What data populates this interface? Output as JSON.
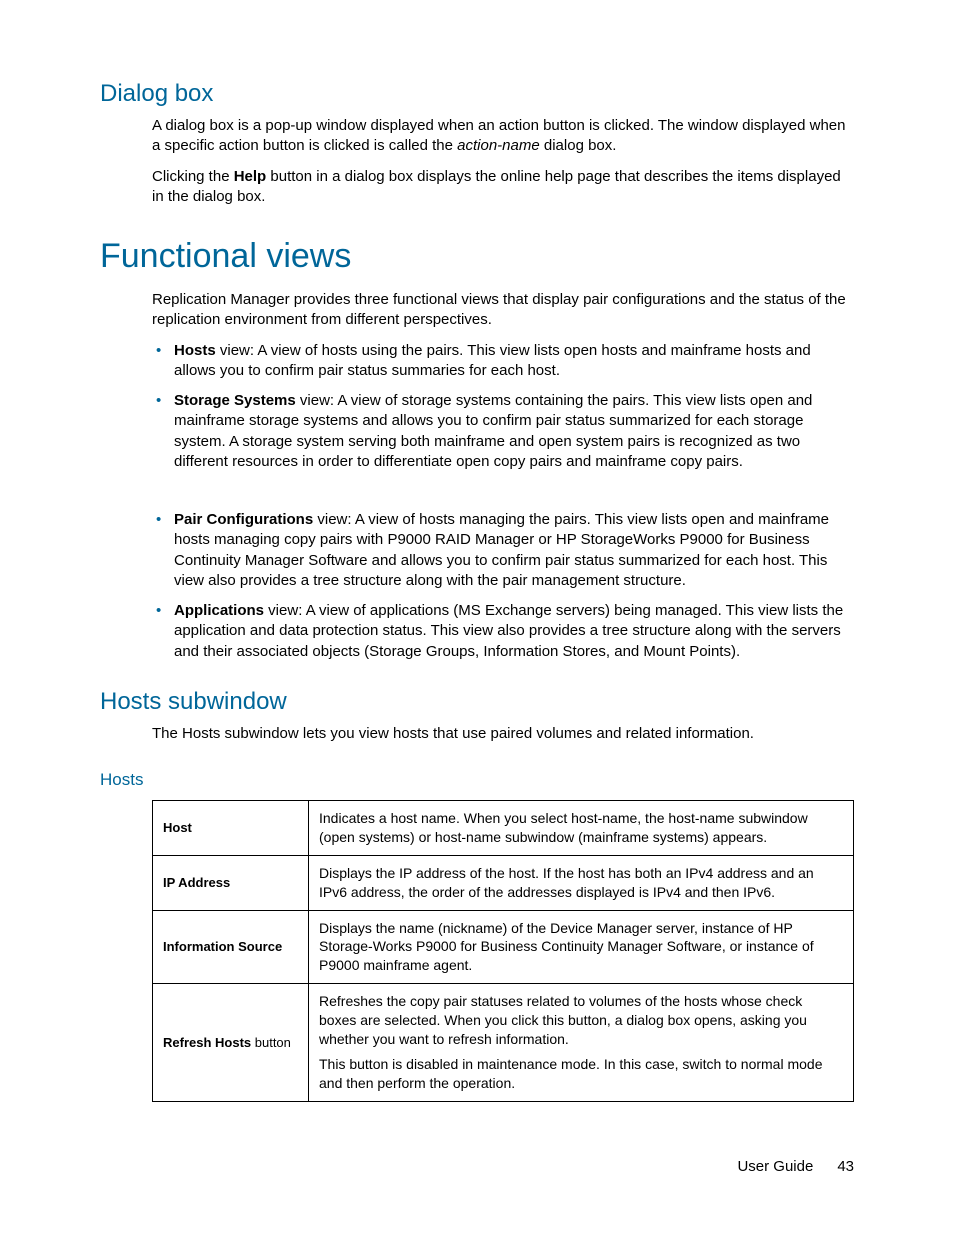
{
  "sec1": {
    "title": "Dialog box",
    "p1a": "A dialog box is a pop-up window displayed when an action button is clicked. The window displayed when a specific action button is clicked is called the ",
    "p1i": "action-name",
    "p1b": " dialog box.",
    "p2a": "Clicking the ",
    "p2bold": "Help",
    "p2b": " button in a dialog box displays the online help page that describes the items displayed in the dialog box."
  },
  "sec2": {
    "title": "Functional views",
    "intro": "Replication Manager provides three functional views that display pair configurations and the status of the replication environment from different perspectives.",
    "items": [
      {
        "bold": "Hosts",
        "rest": " view: A view of hosts using the pairs. This view lists open hosts and mainframe hosts and allows you to confirm pair status summaries for each host."
      },
      {
        "bold": "Storage Systems",
        "rest": " view: A view of storage systems containing the pairs. This view lists open and mainframe storage systems and allows you to confirm pair status summarized for each storage system. A storage system serving both mainframe and open system pairs is recognized as two different resources in order to differentiate open copy pairs and mainframe copy pairs."
      },
      {
        "bold": "Pair Configurations",
        "rest": " view: A view of hosts managing the pairs. This view lists open and mainframe hosts managing copy pairs with P9000 RAID Manager or HP StorageWorks P9000 for Business Continuity Manager Software and allows you to confirm pair status summarized for each host. This view also provides a tree structure along with the pair management structure."
      },
      {
        "bold": "Applications",
        "rest": " view: A view of applications (MS Exchange servers) being managed. This view lists the application and data protection status. This view also provides a tree structure along with the servers and their associated objects (Storage Groups, Information Stores, and Mount Points)."
      }
    ]
  },
  "sec3": {
    "title": "Hosts subwindow",
    "intro": "The Hosts subwindow lets you view hosts that use paired volumes and related information.",
    "sub": "Hosts",
    "rows": [
      {
        "label": "Host",
        "desc": "Indicates a host name. When you select host-name, the host-name subwindow (open systems) or host-name subwindow (mainframe systems) appears."
      },
      {
        "label": "IP Address",
        "desc": "Displays the IP address of the host. If the host has both an IPv4 address and an IPv6 address, the order of the addresses displayed is IPv4 and then IPv6."
      },
      {
        "label": "Information Source",
        "desc": "Displays the name (nickname) of the Device Manager server, instance of HP Storage-Works P9000 for Business Continuity Manager Software, or instance of P9000 mainframe agent."
      },
      {
        "label": "Refresh Hosts",
        "labelSuffix": " button",
        "desc1": "Refreshes the copy pair statuses related to volumes of the hosts whose check boxes are selected. When you click this button, a dialog box opens, asking you whether you want to refresh information.",
        "desc2": "This button is disabled in maintenance mode. In this case, switch to normal mode and then perform the operation."
      }
    ]
  },
  "footer": {
    "doc": "User Guide",
    "page": "43"
  }
}
